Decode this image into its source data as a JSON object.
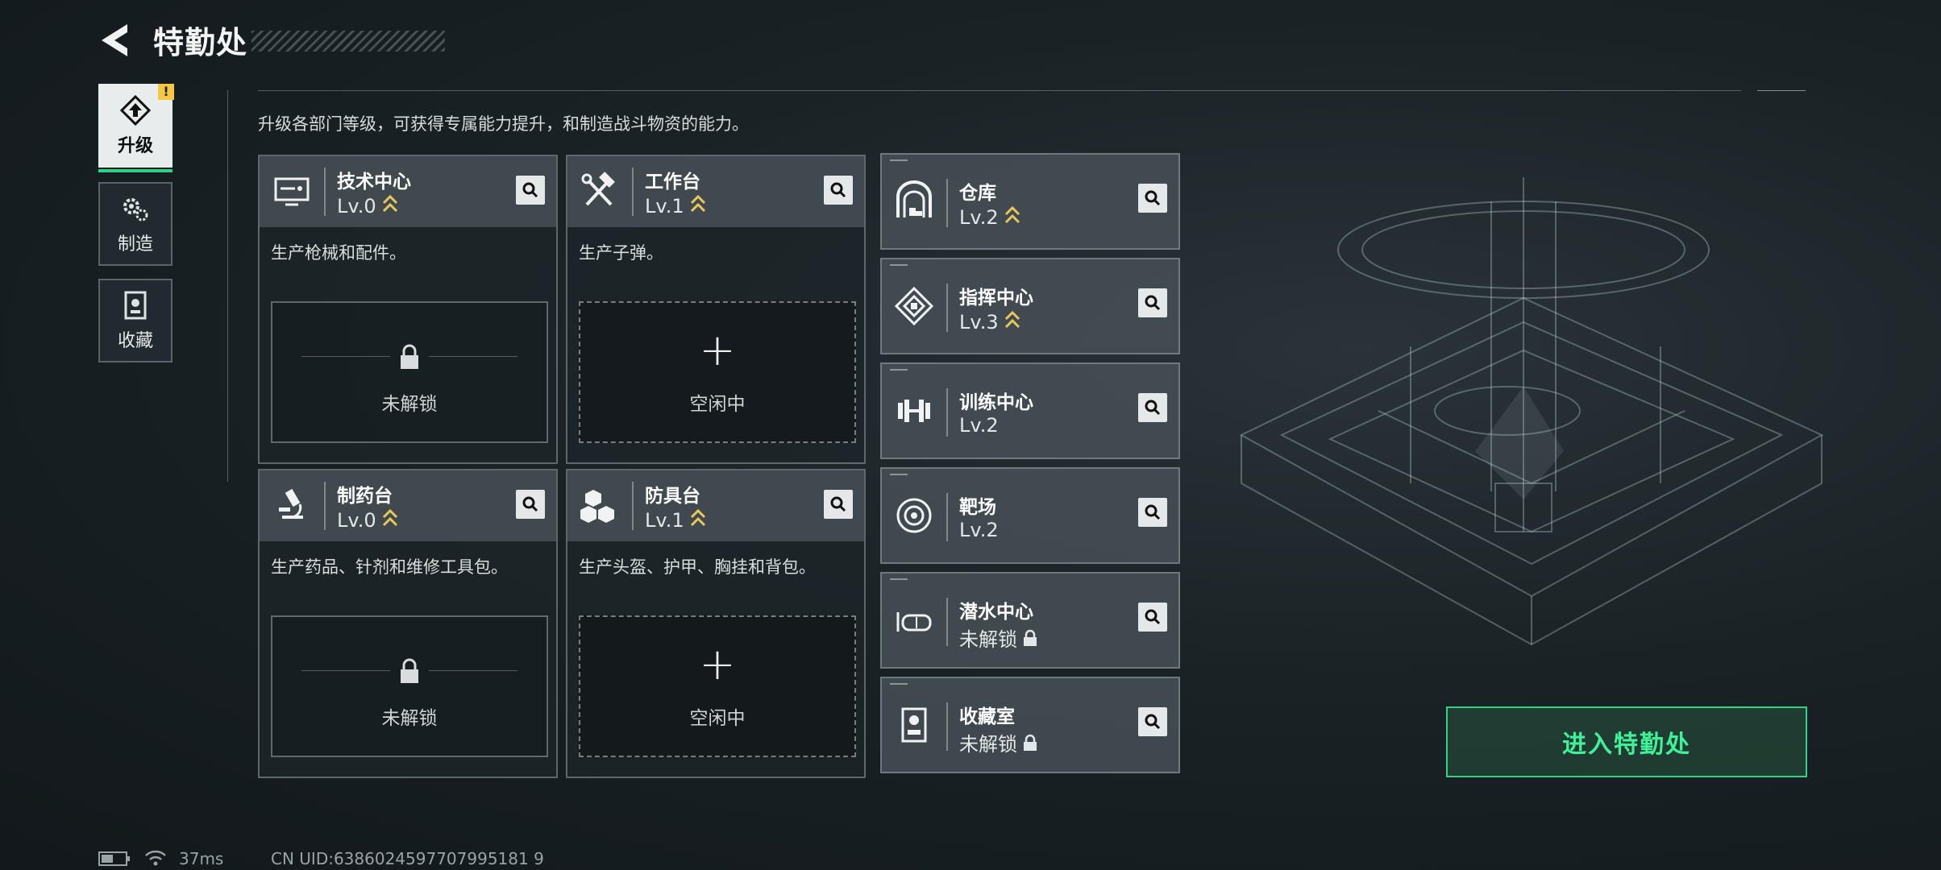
{
  "header": {
    "title": "特勤处"
  },
  "nav": [
    {
      "label": "升级",
      "active": true,
      "badge": "!"
    },
    {
      "label": "制造",
      "active": false
    },
    {
      "label": "收藏",
      "active": false
    }
  ],
  "description": "升级各部门等级，可获得专属能力提升，和制造战斗物资的能力。",
  "cards": [
    {
      "name": "技术中心",
      "level": "Lv.0",
      "desc": "生产枪械和配件。",
      "slot": "未解锁",
      "icon": "monitor-icon"
    },
    {
      "name": "工作台",
      "level": "Lv.1",
      "desc": "生产子弹。",
      "slot": "空闲中",
      "icon": "hammer-wrench-icon"
    },
    {
      "name": "制药台",
      "level": "Lv.0",
      "desc": "生产药品、针剂和维修工具包。",
      "slot": "未解锁",
      "icon": "microscope-icon"
    },
    {
      "name": "防具台",
      "level": "Lv.1",
      "desc": "生产头盔、护甲、胸挂和背包。",
      "slot": "空闲中",
      "icon": "cubes-icon"
    }
  ],
  "facilities": [
    {
      "name": "仓库",
      "level": "Lv.2",
      "icon": "warehouse-icon"
    },
    {
      "name": "指挥中心",
      "level": "Lv.3",
      "icon": "command-icon"
    },
    {
      "name": "训练中心",
      "level": "Lv.2",
      "icon": "dumbbell-icon"
    },
    {
      "name": "靶场",
      "level": "Lv.2",
      "icon": "target-icon"
    },
    {
      "name": "潜水中心",
      "level": "未解锁",
      "icon": "diving-mask-icon"
    },
    {
      "name": "收藏室",
      "level": "未解锁",
      "icon": "display-case-icon"
    }
  ],
  "enter_button": "进入特勤处",
  "status": {
    "ping": "37ms",
    "uid": "CN UID:6386024597707995181 9"
  },
  "colors": {
    "accent": "#2fd386",
    "level_chevron": "#e8c85a",
    "warning": "#f4c842"
  }
}
